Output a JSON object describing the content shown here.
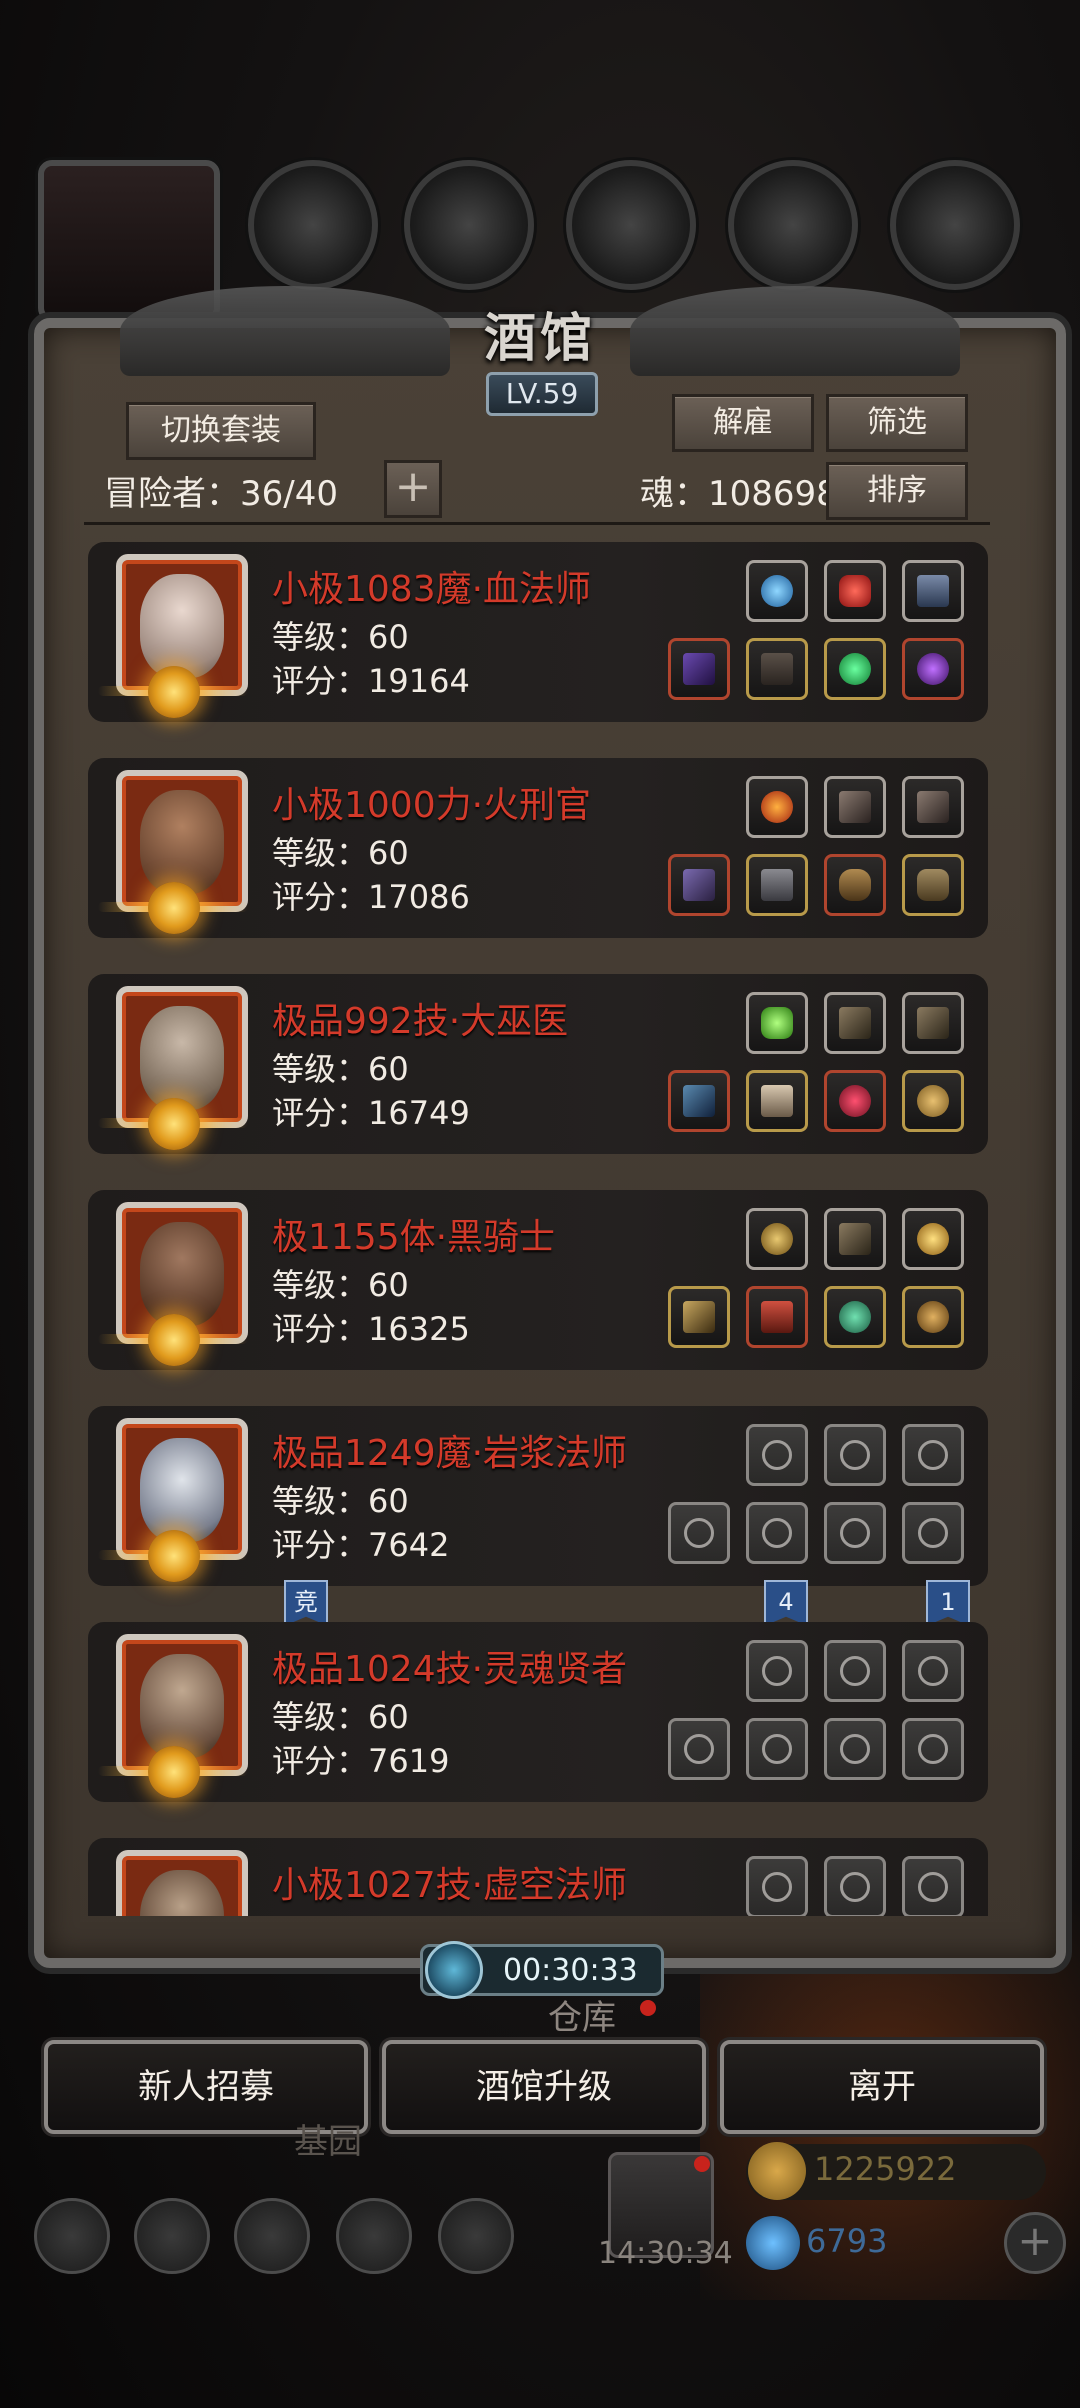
{
  "tavern": {
    "title": "酒馆",
    "level": "LV.59",
    "switch_outfit_label": "切换套装",
    "dismiss_label": "解雇",
    "filter_label": "筛选",
    "sort_label": "排序",
    "adventurer_count": "冒险者：36/40",
    "add_label": "+",
    "soul": "魂：108698"
  },
  "heroes": [
    {
      "name": "小极1083魔·血法师",
      "level": "等级：60",
      "score": "评分：19164"
    },
    {
      "name": "小极1000力·火刑官",
      "level": "等级：60",
      "score": "评分：17086"
    },
    {
      "name": "极品992技·大巫医",
      "level": "等级：60",
      "score": "评分：16749"
    },
    {
      "name": "极1155体·黑骑士",
      "level": "等级：60",
      "score": "评分：16325"
    },
    {
      "name": "极品1249魔·岩浆法师",
      "level": "等级：60",
      "score": "评分：7642"
    },
    {
      "name": "极品1024技·灵魂贤者",
      "level": "等级：60",
      "score": "评分：7619"
    },
    {
      "name": "小极1027技·虚空法师",
      "level": "",
      "score": ""
    }
  ],
  "tags": {
    "compete": "竞",
    "four": "4",
    "one": "1"
  },
  "timer": "00:30:33",
  "warehouse": "仓库",
  "garden": "基园",
  "buttons": {
    "recruit": "新人招募",
    "upgrade": "酒馆升级",
    "leave": "离开"
  },
  "gift_timer": "14:30:34",
  "currency": {
    "gold": "1225922",
    "gems": "6793"
  },
  "colors": {
    "hero_name": "#d43a2a",
    "panel": "#3d352d"
  }
}
